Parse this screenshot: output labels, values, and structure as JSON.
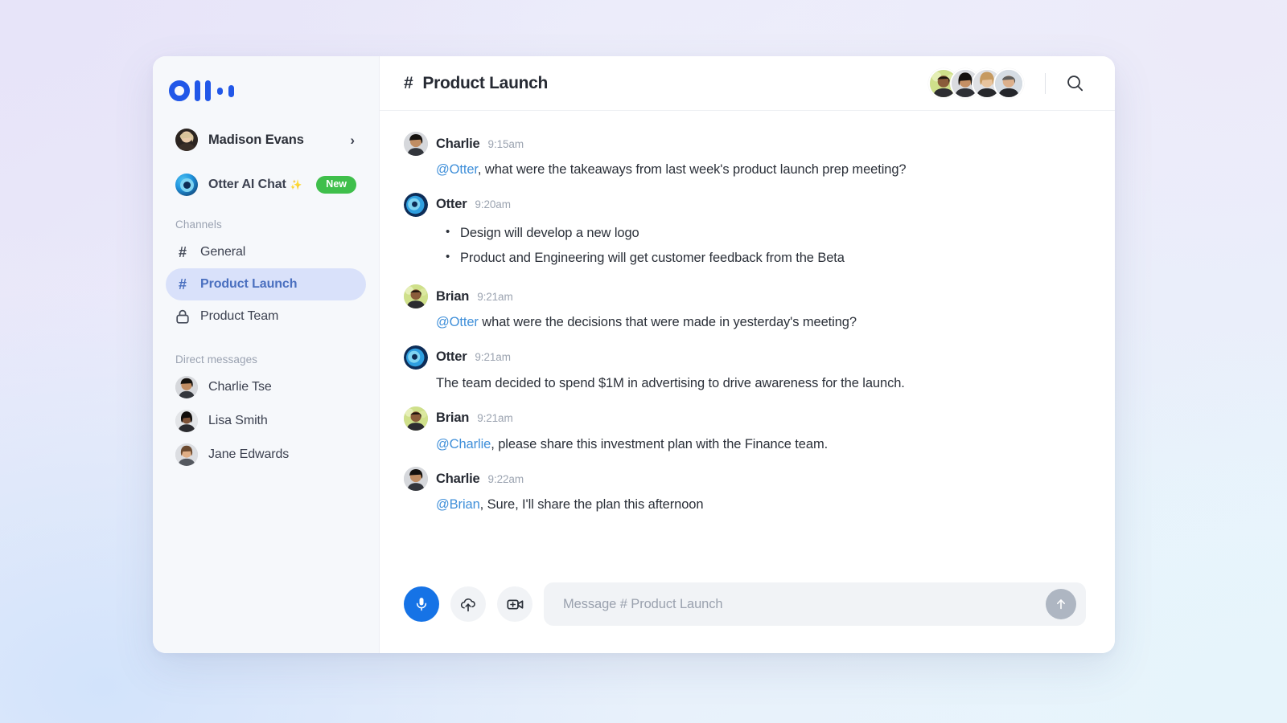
{
  "app": {
    "logo_name": "otter-logo",
    "brand_color": "#2157e8"
  },
  "sidebar": {
    "user": {
      "name": "Madison Evans",
      "chevron": "›"
    },
    "otter_ai": {
      "label": "Otter AI Chat",
      "sparkle": "✨",
      "badge": "New"
    },
    "channels_label": "Channels",
    "channels": [
      {
        "icon": "hash-icon",
        "hash": "#",
        "name": "General",
        "active": false
      },
      {
        "icon": "hash-icon",
        "hash": "#",
        "name": "Product Launch",
        "active": true
      },
      {
        "icon": "lock-icon",
        "hash": "",
        "name": "Product Team",
        "active": false
      }
    ],
    "dm_label": "Direct messages",
    "direct_messages": [
      {
        "name": "Charlie Tse"
      },
      {
        "name": "Lisa Smith"
      },
      {
        "name": "Jane Edwards"
      }
    ]
  },
  "header": {
    "hash": "#",
    "title": "Product Launch",
    "member_count": 4,
    "search_icon": "search-icon"
  },
  "messages": [
    {
      "author": "Charlie",
      "time": "9:15am",
      "avatar": "charlie",
      "mention": "@Otter",
      "mention_suffix": ", what were the takeaways from last week's product launch prep meeting?",
      "bullets": []
    },
    {
      "author": "Otter",
      "time": "9:20am",
      "avatar": "otter",
      "mention": "",
      "mention_suffix": "",
      "bullets": [
        "Design will develop a new logo",
        "Product and Engineering will get customer feedback from the Beta"
      ]
    },
    {
      "author": "Brian",
      "time": "9:21am",
      "avatar": "brian",
      "mention": "@Otter",
      "mention_suffix": " what were the decisions that were made in yesterday's meeting?",
      "bullets": []
    },
    {
      "author": "Otter",
      "time": "9:21am",
      "avatar": "otter",
      "mention": "",
      "mention_suffix": "The team decided to spend $1M in advertising to drive awareness for the launch.",
      "bullets": []
    },
    {
      "author": "Brian",
      "time": "9:21am",
      "avatar": "brian",
      "mention": "@Charlie",
      "mention_suffix": ", please share this investment plan with the Finance team.",
      "bullets": []
    },
    {
      "author": "Charlie",
      "time": "9:22am",
      "avatar": "charlie",
      "mention": "@Brian",
      "mention_suffix": ", Sure, I'll share the plan this afternoon",
      "bullets": []
    }
  ],
  "composer": {
    "mic_icon": "microphone-icon",
    "upload_icon": "cloud-upload-icon",
    "video_icon": "add-video-icon",
    "placeholder": "Message # Product Launch",
    "value": "",
    "send_icon": "arrow-up-icon"
  }
}
